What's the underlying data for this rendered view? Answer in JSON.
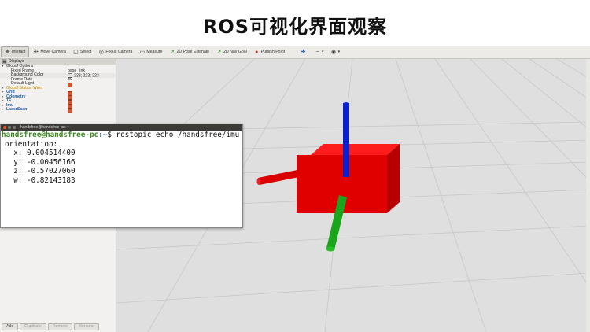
{
  "slide_title": "ROS可视化界面观察",
  "toolbar": {
    "items": [
      {
        "label": "Interact",
        "icon": "interact-icon"
      },
      {
        "label": "Move Camera",
        "icon": "move-camera-icon"
      },
      {
        "label": "Select",
        "icon": "select-icon"
      },
      {
        "label": "Focus Camera",
        "icon": "focus-camera-icon"
      },
      {
        "label": "Measure",
        "icon": "measure-icon"
      },
      {
        "label": "2D Pose Estimate",
        "icon": "pose-estimate-icon"
      },
      {
        "label": "2D Nav Goal",
        "icon": "nav-goal-icon"
      },
      {
        "label": "Publish Point",
        "icon": "publish-point-icon"
      }
    ],
    "extra_icons": [
      "plus-icon",
      "minus-icon",
      "eye-icon"
    ]
  },
  "displays": {
    "header": "Displays",
    "global_options": "Global Options",
    "fixed_frame_label": "Fixed Frame",
    "fixed_frame_value": "base_link",
    "background_color_label": "Background Color",
    "background_color_value": "223; 223; 223",
    "frame_rate_label": "Frame Rate",
    "frame_rate_value": "30",
    "default_light_label": "Default Light",
    "global_status": "Global Status: Warn",
    "items": [
      "Grid",
      "Odometry",
      "TF",
      "Imu",
      "LaserScan"
    ]
  },
  "buttons": {
    "add": "Add",
    "duplicate": "Duplicate",
    "remove": "Remove",
    "rename": "Rename"
  },
  "terminal": {
    "title": "handsfree@handsfree-pc: ~",
    "prompt_user": "handsfree@handsfree-pc",
    "prompt_path": ":~",
    "command": "$ rostopic echo /handsfree/imu",
    "lines": [
      "orientation:",
      "  x: 0.004514400",
      "  y: -0.00456166",
      "  z: -0.57027060",
      "  w: -0.82143183"
    ]
  },
  "colors": {
    "background": "#dfdfdf",
    "box": "#e00000",
    "axis_x": "#e00000",
    "axis_y": "#1aa61a",
    "axis_z": "#0a1fd0"
  }
}
